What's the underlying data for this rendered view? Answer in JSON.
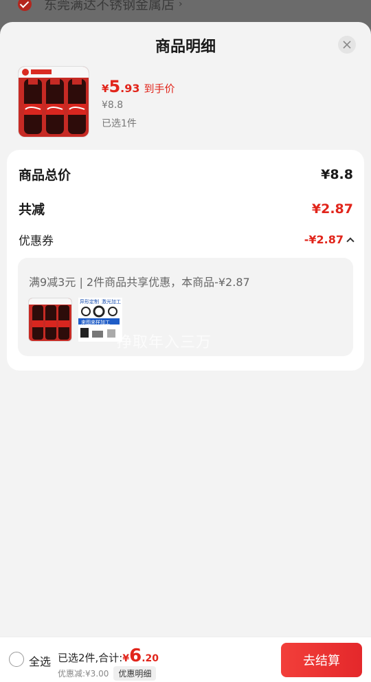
{
  "background": {
    "store_name": "东莞满达不锈钢金属店"
  },
  "sheet": {
    "title": "商品明细",
    "product": {
      "price_currency": "¥",
      "price_int": "5",
      "price_dec": ".93",
      "price_tag": "到手价",
      "original_price": "¥8.8",
      "selected_count": "已选1件"
    }
  },
  "details": {
    "total_label": "商品总价",
    "total_value": "¥8.8",
    "reduced_label": "共减",
    "reduced_value": "¥2.87",
    "coupon_label": "优惠券",
    "coupon_value": "-¥2.87",
    "promo_text": "满9减3元 | 2件商品共享优惠，本商品-¥2.87",
    "promo_item2_labels": [
      "异形定制",
      "激光加工",
      "来图来样加工"
    ]
  },
  "watermark": "挣取年入三万",
  "bottom": {
    "select_all": "全选",
    "summary_prefix": "已选2件,合计:",
    "total_currency": "¥",
    "total_int": "6",
    "total_dec": ".20",
    "discount_text": "优惠减:¥3.00",
    "detail_chip": "优惠明细",
    "checkout": "去结算"
  },
  "colors": {
    "accent": "#e1251b",
    "button": "#ef3535",
    "sheet_bg": "#f3f3f3"
  }
}
